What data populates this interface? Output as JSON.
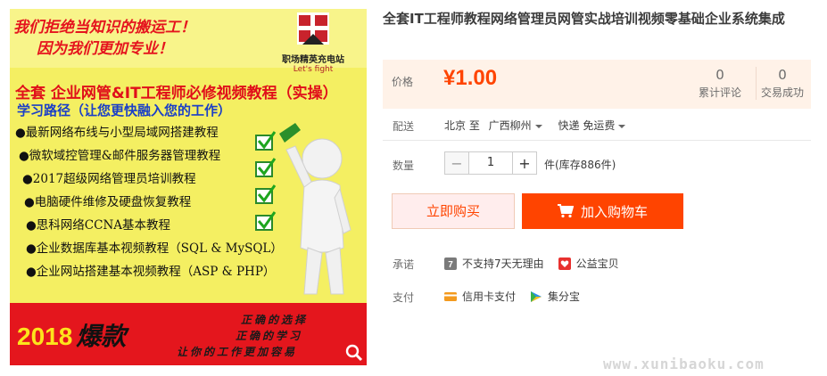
{
  "image": {
    "slogan_line1": "我们拒绝当知识的搬运工！",
    "slogan_line2": "因为我们更加专业！",
    "brand_name": "职场精英充电站",
    "brand_sub": "Let's fight",
    "headline": "全套 企业网管&IT工程师必修视频教程（实操）",
    "subline": "学习路径（让您更快融入您的工作）",
    "courses": [
      "●最新网络布线与小型局域网搭建教程",
      "●微软域控管理&邮件服务器管理教程",
      "●2017超级网络管理员培训教程",
      "●电脑硬件维修及硬盘恢复教程",
      "●思科网络CCNA基本教程",
      "●企业数据库基本视频教程（SQL & MySQL）",
      "●企业网站搭建基本视频教程（ASP & PHP）"
    ],
    "year": "2018",
    "year_suffix": "爆款",
    "taglines": [
      "正确的选择",
      "正确的学习",
      "让你的工作更加容易"
    ]
  },
  "product": {
    "title": "全套IT工程师教程网络管理员网管实战培训视频零基础企业系统集成"
  },
  "price": {
    "label": "价格",
    "value": "¥1.00",
    "reviews_count": "0",
    "reviews_label": "累计评论",
    "trades_count": "0",
    "trades_label": "交易成功"
  },
  "delivery": {
    "label": "配送",
    "from": "北京 至",
    "to": "广西柳州",
    "method": "快递 免运费"
  },
  "quantity": {
    "label": "数量",
    "minus": "−",
    "value": "1",
    "plus": "+",
    "stock": "件(库存886件)"
  },
  "actions": {
    "buy_now": "立即购买",
    "add_to_cart": "加入购物车"
  },
  "promise": {
    "label": "承诺",
    "no_return": "不支持7天无理由",
    "charity": "公益宝贝"
  },
  "payment": {
    "label": "支付",
    "credit_card": "信用卡支付",
    "jifenbao": "集分宝"
  },
  "watermark": "www.xunibaoku.com",
  "colors": {
    "accent": "#ff4400",
    "price_bg": "#fff2e8",
    "image_red": "#e4161d",
    "image_yellow": "#f4ef62"
  }
}
